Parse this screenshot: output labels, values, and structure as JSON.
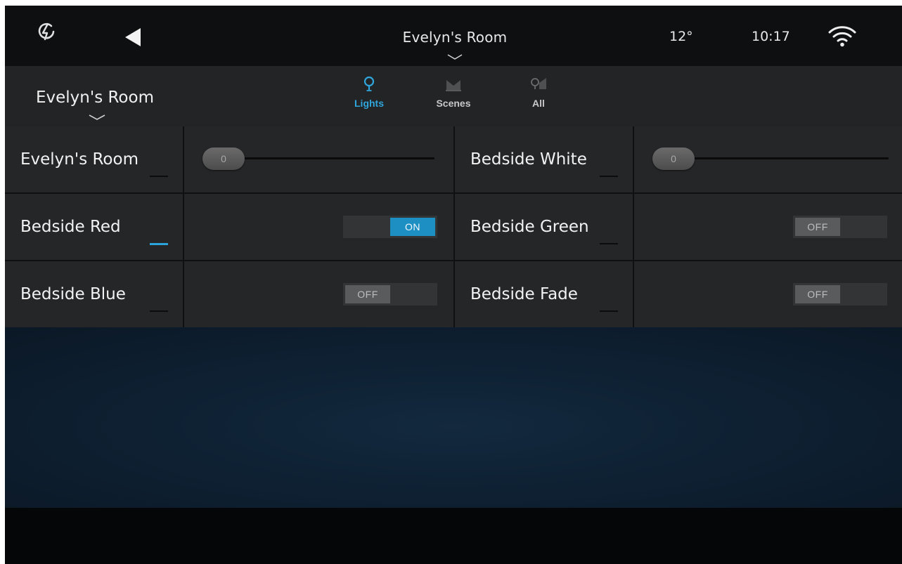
{
  "statusbar": {
    "title": "Evelyn's Room",
    "temperature": "12°",
    "time": "10:17"
  },
  "header": {
    "room_selector": "Evelyn's Room",
    "tabs": [
      {
        "label": "Lights",
        "active": true
      },
      {
        "label": "Scenes",
        "active": false
      },
      {
        "label": "All",
        "active": false
      }
    ]
  },
  "colors": {
    "accent": "#2fa6dc",
    "toggle_on": "#1e8fc3",
    "panel": "#252628",
    "background": "#0e2133"
  },
  "devices": [
    {
      "name": "Evelyn's Room",
      "type": "dimmer",
      "level": "0",
      "active": false
    },
    {
      "name": "Bedside White",
      "type": "dimmer",
      "level": "0",
      "active": false
    },
    {
      "name": "Bedside Red",
      "type": "switch",
      "state": "ON",
      "active": true
    },
    {
      "name": "Bedside Green",
      "type": "switch",
      "state": "OFF",
      "active": false
    },
    {
      "name": "Bedside Blue",
      "type": "switch",
      "state": "OFF",
      "active": false
    },
    {
      "name": "Bedside Fade",
      "type": "switch",
      "state": "OFF",
      "active": false
    }
  ]
}
